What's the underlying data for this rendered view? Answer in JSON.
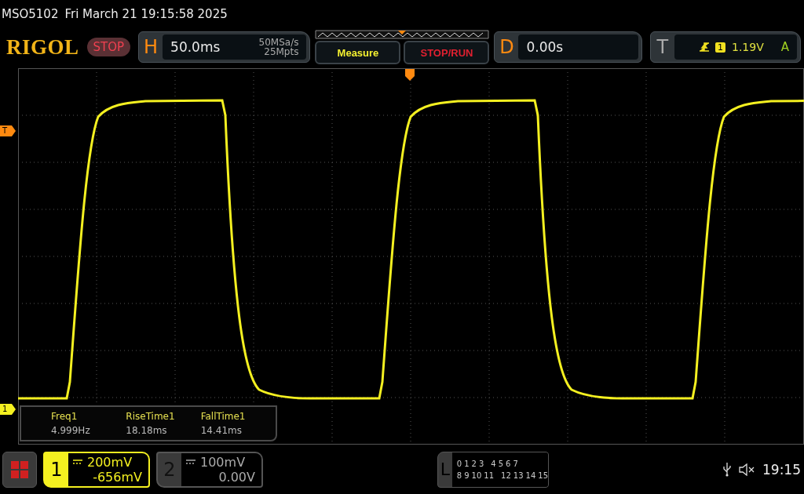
{
  "status_line": {
    "model": "MSO5102",
    "datetime": "Fri March 21 19:15:58 2025"
  },
  "header": {
    "logo": "RIGOL",
    "run_state": "STOP",
    "horizontal": {
      "letter": "H",
      "timebase": "50.0ms",
      "sample_rate": "50MSa/s",
      "memory_depth": "25Mpts"
    },
    "measure_button": "Measure",
    "stop_run_button": "STOP/RUN",
    "delay": {
      "letter": "D",
      "value": "0.00s"
    },
    "trigger": {
      "letter": "T",
      "source": "1",
      "level": "1.19V",
      "mode": "A"
    }
  },
  "markers": {
    "trigger_level": "T",
    "channel": "1"
  },
  "measurements": [
    {
      "label": "Freq1",
      "value": "4.999Hz"
    },
    {
      "label": "RiseTime1",
      "value": "18.18ms"
    },
    {
      "label": "FallTime1",
      "value": "14.41ms"
    }
  ],
  "channels": [
    {
      "number": "1",
      "scale": "200mV",
      "offset": "-656mV",
      "enabled": true
    },
    {
      "number": "2",
      "scale": "100mV",
      "offset": "0.00V",
      "enabled": false
    }
  ],
  "logic": {
    "letter": "L",
    "row_1": [
      "0",
      "1",
      "2",
      "3",
      "4",
      "5",
      "6",
      "7"
    ],
    "row_2": [
      "8",
      "9",
      "10",
      "11",
      "12",
      "13",
      "14",
      "15"
    ]
  },
  "clock": "19:15"
}
